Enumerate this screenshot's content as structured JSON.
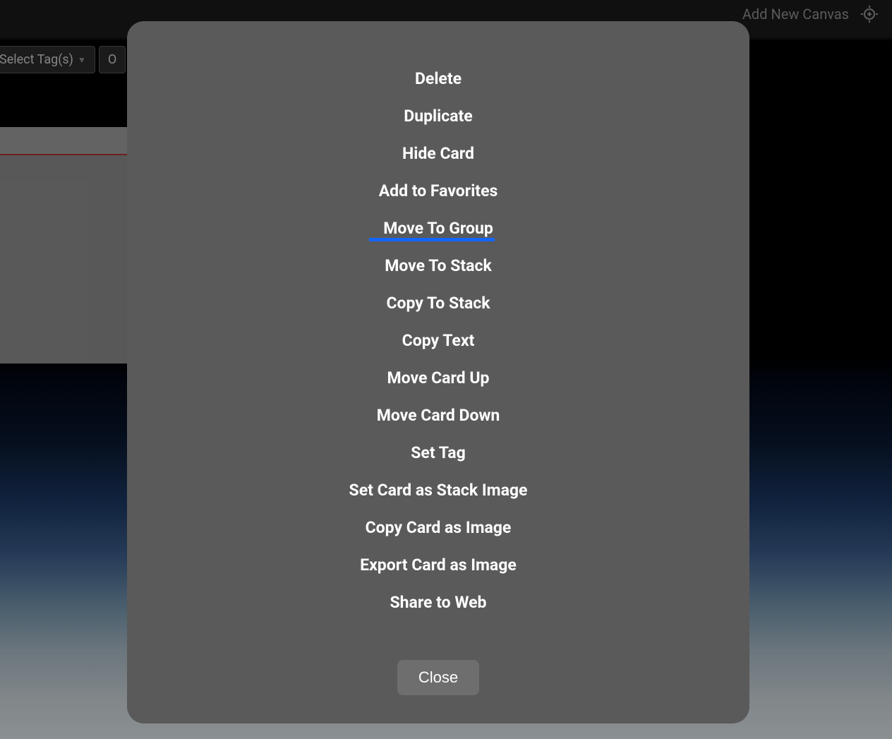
{
  "header": {
    "add_canvas_label": "Add New Canvas"
  },
  "toolbar": {
    "select_tags_label": "Select Tag(s)",
    "second_btn_partial": "O"
  },
  "modal": {
    "menu_items": [
      {
        "label": "Delete",
        "key": "delete",
        "highlighted": false
      },
      {
        "label": "Duplicate",
        "key": "duplicate",
        "highlighted": false
      },
      {
        "label": "Hide Card",
        "key": "hide-card",
        "highlighted": false
      },
      {
        "label": "Add to Favorites",
        "key": "add-to-favorites",
        "highlighted": false
      },
      {
        "label": "Move To Group",
        "key": "move-to-group",
        "highlighted": true
      },
      {
        "label": "Move To Stack",
        "key": "move-to-stack",
        "highlighted": false
      },
      {
        "label": "Copy To Stack",
        "key": "copy-to-stack",
        "highlighted": false
      },
      {
        "label": "Copy Text",
        "key": "copy-text",
        "highlighted": false
      },
      {
        "label": "Move Card Up",
        "key": "move-card-up",
        "highlighted": false
      },
      {
        "label": "Move Card Down",
        "key": "move-card-down",
        "highlighted": false
      },
      {
        "label": "Set Tag",
        "key": "set-tag",
        "highlighted": false
      },
      {
        "label": "Set Card as Stack Image",
        "key": "set-card-as-stack-image",
        "highlighted": false
      },
      {
        "label": "Copy Card as Image",
        "key": "copy-card-as-image",
        "highlighted": false
      },
      {
        "label": "Export Card as Image",
        "key": "export-card-as-image",
        "highlighted": false
      },
      {
        "label": "Share to Web",
        "key": "share-to-web",
        "highlighted": false
      }
    ],
    "close_label": "Close"
  }
}
